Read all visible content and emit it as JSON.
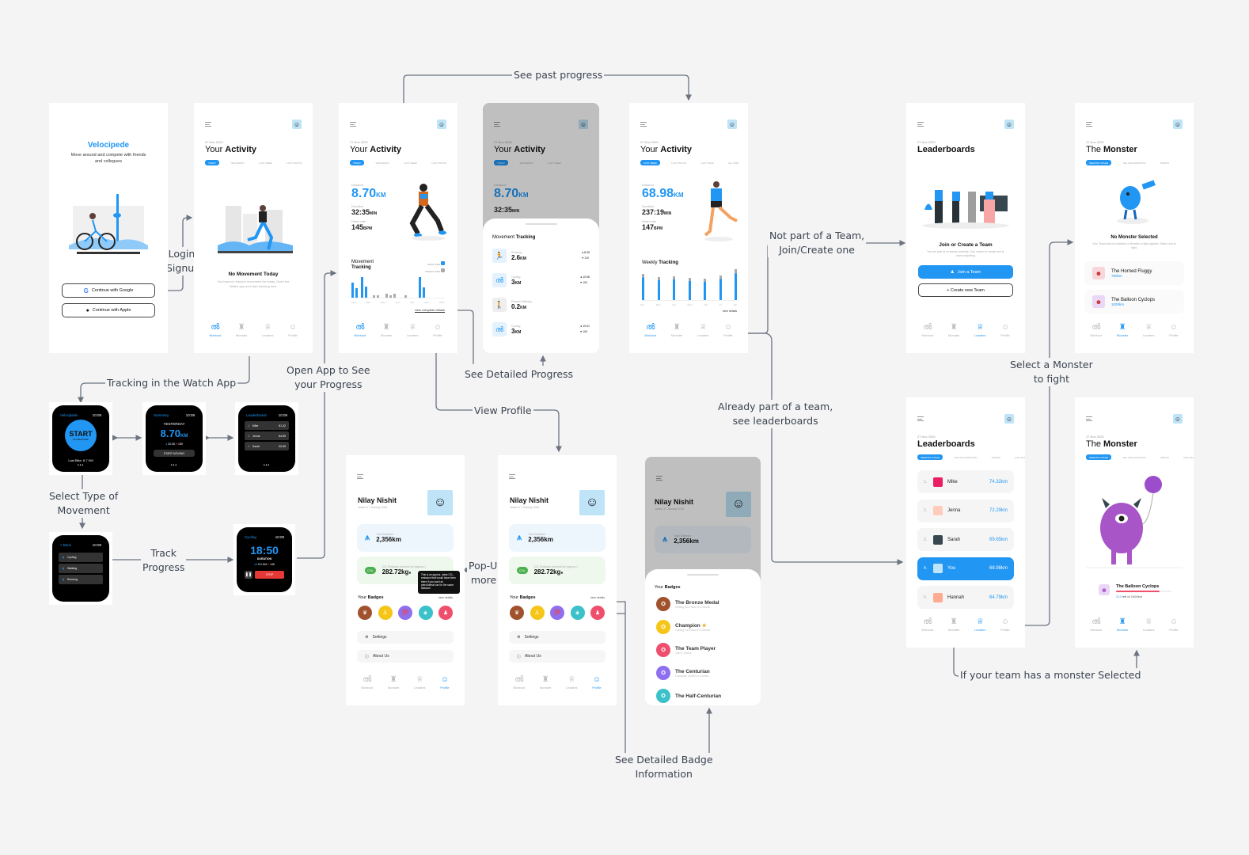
{
  "flow_labels": {
    "see_past_progress": "See past progress",
    "login_signup": [
      "Login/",
      "Signup"
    ],
    "not_part_of_team": [
      "Not part of a Team,",
      "Join/Create one"
    ],
    "tracking_watch": "Tracking in the Watch App",
    "open_app": [
      "Open App to See",
      "your Progress"
    ],
    "see_detailed_progress": "See Detailed Progress",
    "view_profile": "View Profile",
    "already_team": [
      "Already part of a team,",
      "see leaderboards"
    ],
    "select_monster": [
      "Select a Monster",
      "to fight"
    ],
    "select_type": [
      "Select Type of",
      "Movement"
    ],
    "track_progress": [
      "Track",
      "Progress"
    ],
    "popup_info": [
      "Pop-Up for",
      "more info"
    ],
    "detailed_badge": [
      "See Detailed Badge",
      "Information"
    ],
    "team_monster": "If your team has a monster Selected"
  },
  "common": {
    "date": "27 Nov 2020",
    "nav": [
      "Workout",
      "Monster",
      "Leaders",
      "Profile"
    ],
    "activity_tabs": [
      "TODAY",
      "YESTERDAY",
      "LAST WEEK",
      "LAST MONTH",
      "LAST YEAR"
    ],
    "activity_tabs_week": [
      "LAST WEEK",
      "LAST MONTH",
      "LAST YEAR",
      "ALL TIME"
    ],
    "monster_tabs": [
      "SEEKING STAGE",
      "THE ORGANIZATION",
      "VIDEOS",
      "JOIN TEAM"
    ],
    "accent": "#2196f3"
  },
  "login": {
    "app_name": "Velocipede",
    "tagline": "Move around and compete with friends and collegues",
    "google_btn": "Continue with Google",
    "apple_btn": "Continue with Apple"
  },
  "activity_empty": {
    "title_light": "Your ",
    "title_bold": "Activity",
    "empty_title": "No Movement Today",
    "empty_desc": "You have no tracked movement for today. Open the Watch app and start tracking now."
  },
  "activity_today": {
    "distance_label": "Distance",
    "distance": "8.70",
    "distance_unit": "KM",
    "duration_label": "Duration",
    "duration": "32:35",
    "duration_unit": "MIN",
    "hr_label": "Heart-rate",
    "hr": "145",
    "hr_unit": "BPM",
    "movement_title_light": "Movement",
    "movement_title_bold": "Tracking",
    "legend_active": "Active Track",
    "legend_passive": "Passive Track",
    "x_labels": [
      "1am",
      "6am",
      "11am",
      "1pm",
      "4pm",
      "9pm",
      "12am"
    ],
    "view_details": "view complete details"
  },
  "movement_sheet": {
    "title_light": "Movement ",
    "title_bold": "Tracking",
    "items": [
      {
        "type": "Running",
        "dist": "2.6",
        "unit": "KM",
        "time": "8:35",
        "hr": "139",
        "icon": "run"
      },
      {
        "type": "Cycling",
        "dist": "3",
        "unit": "KM",
        "time": "10:08",
        "hr": "165",
        "icon": "bike"
      },
      {
        "type": "Passive Walking",
        "dist": "0.2",
        "unit": "KM",
        "time": "",
        "hr": "",
        "icon": "walk"
      },
      {
        "type": "Cycling",
        "dist": "3",
        "unit": "KM",
        "time": "10:01",
        "hr": "168",
        "icon": "bike"
      }
    ]
  },
  "activity_week": {
    "distance": "68.98",
    "duration": "237:19",
    "hr": "147",
    "weekly_light": "Weekly ",
    "weekly_bold": "Tracking",
    "days": [
      "Sun",
      "Mon",
      "Tue",
      "Wed",
      "Thu",
      "Fri",
      "Sat"
    ],
    "view_details": "view details"
  },
  "leaderboard_join": {
    "title": "Leaderboards",
    "heading": "Join or Create a Team",
    "desc": "You are part of no teams currently. Join a team or create one to start competing",
    "join_btn": "Join a Team",
    "create_btn": "+ Create new Team"
  },
  "monster_empty": {
    "title_light": "The ",
    "title_bold": "Monster",
    "heading": "No Monster Selected",
    "desc": "Your Team has not selected a Monster to fight against. Select one to fight.",
    "monsters": [
      {
        "name": "The Horned Fluggy",
        "dist": "750km",
        "color": "#f8d7da"
      },
      {
        "name": "The Balloon Cyclops",
        "dist": "1000km",
        "color": "#ead7f5"
      }
    ]
  },
  "leaderboard": {
    "title": "Leaderboards",
    "rows": [
      {
        "rank": "1.",
        "name": "Mike",
        "km": "74.32km",
        "me": false,
        "color": "#e91e63"
      },
      {
        "rank": "2.",
        "name": "Jenna",
        "km": "72.29km",
        "me": false,
        "color": "#ffccbc"
      },
      {
        "rank": "3.",
        "name": "Sarah",
        "km": "69.65km",
        "me": false,
        "color": "#37474f"
      },
      {
        "rank": "4.",
        "name": "You",
        "km": "68.98km",
        "me": true,
        "color": "#bfe3f7"
      },
      {
        "rank": "5.",
        "name": "Hannah",
        "km": "64.79km",
        "me": false,
        "color": "#ffab91"
      }
    ]
  },
  "monster_active": {
    "name": "The Balloon Cyclops",
    "remaining": "213",
    "remaining_suffix": " left of 1000km",
    "progress": 0.787
  },
  "profile": {
    "name": "Nilay Nishit",
    "joined": "Joined 17 January 2020",
    "total_label": "Total Distance",
    "total": "2,356km",
    "co2_label": "CO₂ Emission reduced by (approx.)",
    "co2": "282.72kg",
    "tooltip": "This is an approx. value CO₂ emission that would have been there if you used an petrol/diesel car for the same distance",
    "badges_light": "Your ",
    "badges_bold": "Badges",
    "view_details": "view details",
    "badge_colors": [
      "#a0522d",
      "#f5c518",
      "#8e6ff0",
      "#3bc1c9",
      "#ef4f6d"
    ],
    "settings": "Settings",
    "about": "About Us"
  },
  "badge_sheet": {
    "items": [
      {
        "name": "The Bronze Medal",
        "desc": "Getting 3rd Place in a Month",
        "color": "#a0522d"
      },
      {
        "name": "Champion",
        "desc": "Getting 1st Place in a Month",
        "color": "#f5c518",
        "star": "★"
      },
      {
        "name": "The Team Player",
        "desc": "Join 3 Teams",
        "color": "#ef4f6d"
      },
      {
        "name": "The Centurian",
        "desc": "Complete 100km in a week",
        "color": "#8e6ff0"
      },
      {
        "name": "The Half-Centurian",
        "desc": "",
        "color": "#3bc1c9"
      }
    ]
  },
  "watch": {
    "time": "10:09",
    "start": {
      "app": "Velocipede",
      "btn": "START",
      "sub": "Run/Bike/Walk",
      "last": "Last Bike: 8.7 KM"
    },
    "summary": {
      "app": "Summary",
      "day": "YESTERDAY",
      "dist": "8.70",
      "unit": "KM",
      "time": "32:35",
      "hr": "159",
      "btn": "START MOVING"
    },
    "leaders": {
      "app": "Leaderboard",
      "rows": [
        [
          "1.",
          "Mike",
          "81.32"
        ],
        [
          "2.",
          "Jenna",
          "84.89"
        ],
        [
          "3.",
          "Sarah",
          "90.65"
        ]
      ]
    },
    "select": {
      "back": "< Back",
      "items": [
        "Cycling",
        "Walking",
        "Running"
      ]
    },
    "tracking": {
      "app": "Cycling",
      "time_val": "18:50",
      "dur": "DURATION",
      "km": "5.9 KM",
      "hr": "146",
      "stop": "STOP"
    }
  }
}
